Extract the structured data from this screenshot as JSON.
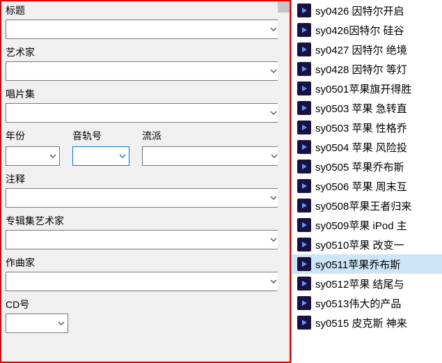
{
  "form": {
    "title_label": "标题",
    "artist_label": "艺术家",
    "album_label": "唱片集",
    "year_label": "年份",
    "track_label": "音轨号",
    "genre_label": "流派",
    "comment_label": "注释",
    "album_artist_label": "专辑集艺术家",
    "composer_label": "作曲家",
    "cd_no_label": "CD号",
    "title_value": "",
    "artist_value": "",
    "album_value": "",
    "year_value": "",
    "track_value": "",
    "genre_value": "",
    "comment_value": "",
    "album_artist_value": "",
    "composer_value": "",
    "cd_no_value": ""
  },
  "files": [
    {
      "name": "sy0426 因特尔开启",
      "selected": false
    },
    {
      "name": "sy0426因特尔 硅谷",
      "selected": false
    },
    {
      "name": "sy0427 因特尔 绝境",
      "selected": false
    },
    {
      "name": "sy0428 因特尔 等灯",
      "selected": false
    },
    {
      "name": "sy0501苹果旗开得胜",
      "selected": false
    },
    {
      "name": "sy0503 苹果 急转直",
      "selected": false
    },
    {
      "name": "sy0503 苹果 性格乔",
      "selected": false
    },
    {
      "name": "sy0504 苹果 风险投",
      "selected": false
    },
    {
      "name": "sy0505 苹果乔布斯",
      "selected": false
    },
    {
      "name": "sy0506 苹果 周末互",
      "selected": false
    },
    {
      "name": "sy0508苹果王者归来",
      "selected": false
    },
    {
      "name": "sy0509苹果 iPod 主",
      "selected": false
    },
    {
      "name": "sy0510苹果 改变一",
      "selected": false
    },
    {
      "name": "sy0511苹果乔布斯",
      "selected": true
    },
    {
      "name": "sy0512苹果 结尾与",
      "selected": false
    },
    {
      "name": "sy0513伟大的产品",
      "selected": false
    },
    {
      "name": "sy0515 皮克斯 神来",
      "selected": false
    }
  ]
}
